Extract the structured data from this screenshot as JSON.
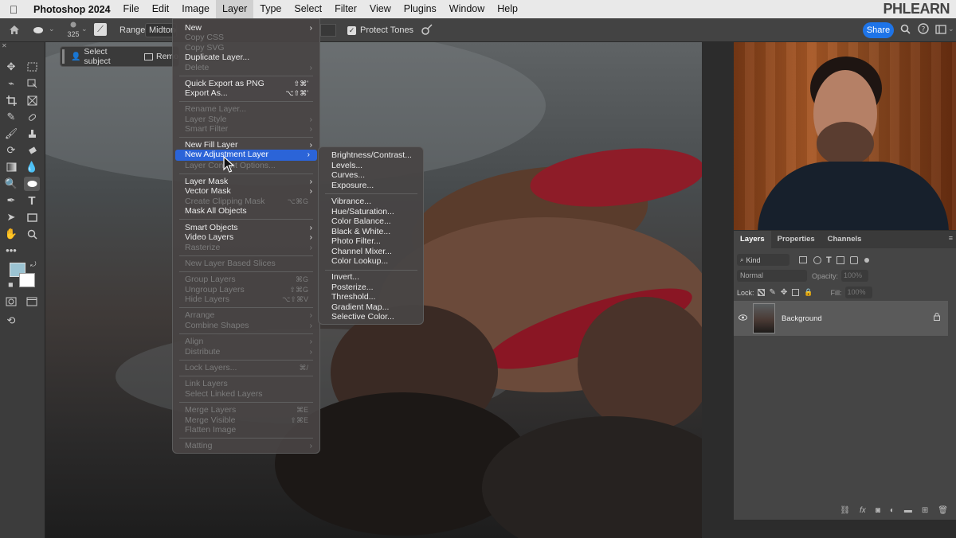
{
  "menubar": {
    "app": "Photoshop 2024",
    "items": [
      "File",
      "Edit",
      "Image",
      "Layer",
      "Type",
      "Select",
      "Filter",
      "View",
      "Plugins",
      "Window",
      "Help"
    ],
    "brand": "PHLEARN"
  },
  "options": {
    "brush_size": "325",
    "range_label": "Range:",
    "range_value": "Midtones",
    "protect_tones": "Protect Tones",
    "share": "Share"
  },
  "context": {
    "select_subject": "Select subject",
    "remove": "Remo"
  },
  "layer_menu": {
    "new": "New",
    "copy_css": "Copy CSS",
    "copy_svg": "Copy SVG",
    "duplicate": "Duplicate Layer...",
    "delete": "Delete",
    "quick_export": "Quick Export as PNG",
    "quick_export_sc": "⇧⌘'",
    "export_as": "Export As...",
    "export_as_sc": "⌥⇧⌘'",
    "rename": "Rename Layer...",
    "layer_style": "Layer Style",
    "smart_filter": "Smart Filter",
    "new_fill": "New Fill Layer",
    "new_adjustment": "New Adjustment Layer",
    "layer_content_options": "Layer Content Options...",
    "layer_mask": "Layer Mask",
    "vector_mask": "Vector Mask",
    "create_clipping": "Create Clipping Mask",
    "create_clipping_sc": "⌥⌘G",
    "mask_all": "Mask All Objects",
    "smart_objects": "Smart Objects",
    "video_layers": "Video Layers",
    "rasterize": "Rasterize",
    "new_slices": "New Layer Based Slices",
    "group_layers": "Group Layers",
    "group_layers_sc": "⌘G",
    "ungroup_layers": "Ungroup Layers",
    "ungroup_layers_sc": "⇧⌘G",
    "hide_layers": "Hide Layers",
    "hide_layers_sc": "⌥⇧⌘V",
    "arrange": "Arrange",
    "combine_shapes": "Combine Shapes",
    "align": "Align",
    "distribute": "Distribute",
    "lock_layers": "Lock Layers...",
    "lock_layers_sc": "⌘/",
    "link_layers": "Link Layers",
    "select_linked": "Select Linked Layers",
    "merge_layers": "Merge Layers",
    "merge_layers_sc": "⌘E",
    "merge_visible": "Merge Visible",
    "merge_visible_sc": "⇧⌘E",
    "flatten": "Flatten Image",
    "matting": "Matting"
  },
  "adjustment_submenu": {
    "brightness": "Brightness/Contrast...",
    "levels": "Levels...",
    "curves": "Curves...",
    "exposure": "Exposure...",
    "vibrance": "Vibrance...",
    "hue_sat": "Hue/Saturation...",
    "color_balance": "Color Balance...",
    "bw": "Black & White...",
    "photo_filter": "Photo Filter...",
    "channel_mixer": "Channel Mixer...",
    "color_lookup": "Color Lookup...",
    "invert": "Invert...",
    "posterize": "Posterize...",
    "threshold": "Threshold...",
    "gradient_map": "Gradient Map...",
    "selective_color": "Selective Color..."
  },
  "layers_panel": {
    "tabs": [
      "Layers",
      "Properties",
      "Channels"
    ],
    "kind": "Kind",
    "blend_mode": "Normal",
    "opacity_label": "Opacity:",
    "opacity_value": "100%",
    "lock_label": "Lock:",
    "fill_label": "Fill:",
    "fill_value": "100%",
    "layer_name": "Background"
  },
  "colors": {
    "accent": "#2b64d8",
    "share": "#1e74e8",
    "foreground": "#9bc3d2",
    "background": "#ffffff"
  }
}
